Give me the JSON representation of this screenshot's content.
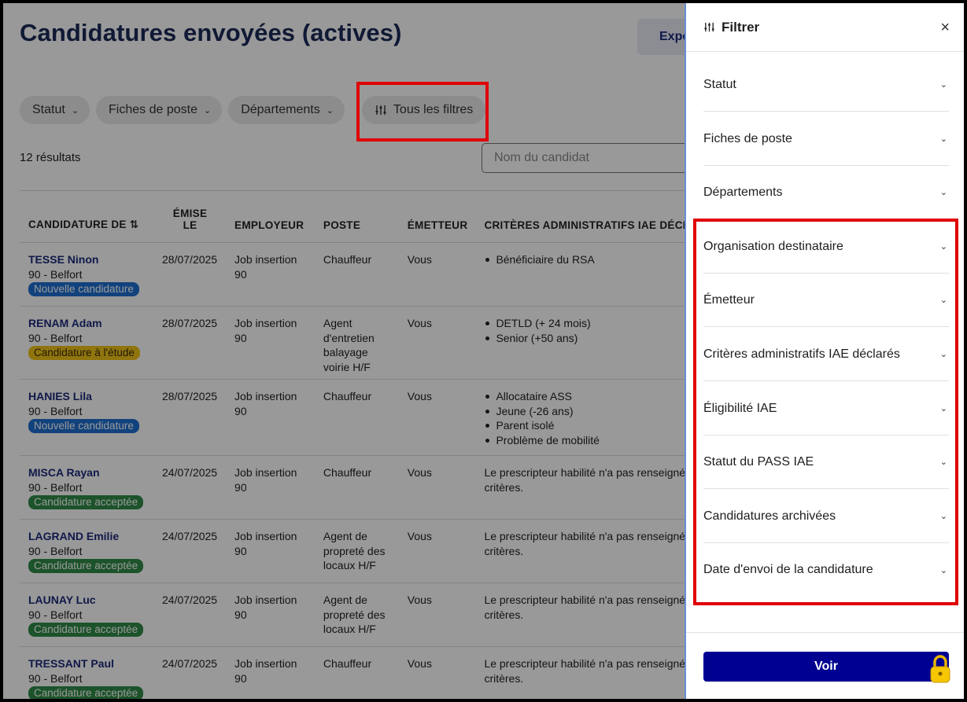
{
  "page": {
    "title": "Candidatures envoyées (actives)",
    "export_label": "Exporter",
    "results_count": "12 résultats",
    "search_placeholder": "Nom du candidat"
  },
  "filters": {
    "chips": [
      {
        "label": "Statut"
      },
      {
        "label": "Fiches de poste"
      },
      {
        "label": "Départements"
      },
      {
        "label": "Tous les filtres"
      }
    ]
  },
  "table": {
    "headers": {
      "candidature": "CANDIDATURE DE ⇅",
      "emise_line1": "ÉMISE",
      "emise_line2": "LE",
      "employeur": "EMPLOYEUR",
      "poste": "POSTE",
      "emetteur": "ÉMETTEUR",
      "criteres": "CRITÈRES ADMINISTRATIFS IAE DÉCLARÉS"
    },
    "rows": [
      {
        "name": "TESSE Ninon",
        "location": "90 - Belfort",
        "status": "Nouvelle candidature",
        "date": "28/07/2025",
        "employer": "Job insertion 90",
        "poste": "Chauffeur",
        "emetteur": "Vous",
        "criteria": [
          "Bénéficiaire du RSA"
        ]
      },
      {
        "name": "RENAM Adam",
        "location": "90 - Belfort",
        "status": "Candidature à l'étude",
        "date": "28/07/2025",
        "employer": "Job insertion 90",
        "poste": "Agent d'entretien balayage voirie H/F",
        "emetteur": "Vous",
        "criteria": [
          "DETLD (+ 24 mois)",
          "Senior (+50 ans)"
        ]
      },
      {
        "name": "HANIES Lila",
        "location": "90 - Belfort",
        "status": "Nouvelle candidature",
        "date": "28/07/2025",
        "employer": "Job insertion 90",
        "poste": "Chauffeur",
        "emetteur": "Vous",
        "criteria": [
          "Allocataire ASS",
          "Jeune (-26 ans)",
          "Parent isolé",
          "Problème de mobilité"
        ]
      },
      {
        "name": "MISCA Rayan",
        "location": "90 - Belfort",
        "status": "Candidature acceptée",
        "date": "24/07/2025",
        "employer": "Job insertion 90",
        "poste": "Chauffeur",
        "emetteur": "Vous",
        "criteria_text": "Le prescripteur habilité n'a pas renseigné de critères."
      },
      {
        "name": "LAGRAND Emilie",
        "location": "90 - Belfort",
        "status": "Candidature acceptée",
        "date": "24/07/2025",
        "employer": "Job insertion 90",
        "poste": "Agent de propreté des locaux H/F",
        "emetteur": "Vous",
        "criteria_text": "Le prescripteur habilité n'a pas renseigné de critères."
      },
      {
        "name": "LAUNAY Luc",
        "location": "90 - Belfort",
        "status": "Candidature acceptée",
        "date": "24/07/2025",
        "employer": "Job insertion 90",
        "poste": "Agent de propreté des locaux H/F",
        "emetteur": "Vous",
        "criteria_text": "Le prescripteur habilité n'a pas renseigné de critères."
      },
      {
        "name": "TRESSANT Paul",
        "location": "90 - Belfort",
        "status": "Candidature acceptée",
        "date": "24/07/2025",
        "employer": "Job insertion 90",
        "poste": "Chauffeur",
        "emetteur": "Vous",
        "criteria_text": "Le prescripteur habilité n'a pas renseigné de critères."
      }
    ]
  },
  "panel": {
    "title": "Filtrer",
    "facets": [
      "Statut",
      "Fiches de poste",
      "Départements",
      "Organisation destinataire",
      "Émetteur",
      "Critères administratifs IAE déclarés",
      "Éligibilité IAE",
      "Statut du PASS IAE",
      "Candidatures archivées",
      "Date d'envoi de la candidature"
    ],
    "submit_label": "Voir"
  },
  "colors": {
    "accent": "#000091",
    "highlight": "#e00000",
    "badge_new": "#1f6fd0",
    "badge_study": "#f0c419",
    "badge_accepted": "#2f8a47"
  }
}
